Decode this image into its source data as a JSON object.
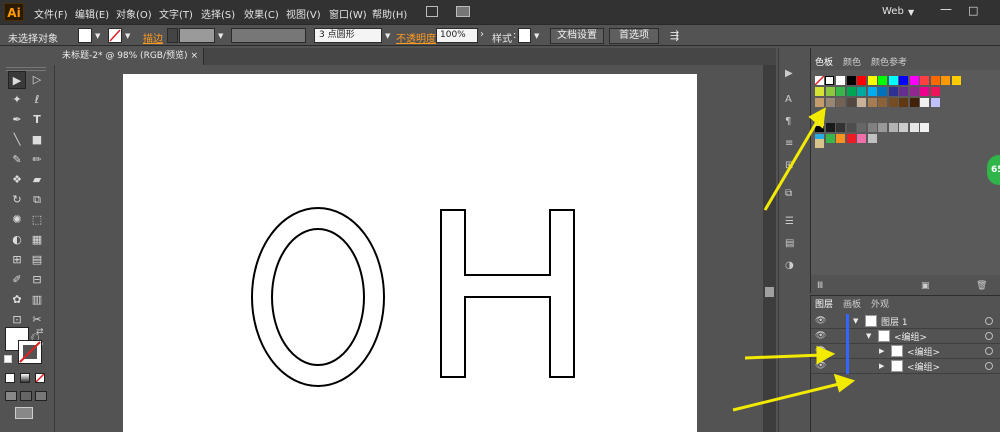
{
  "app": {
    "logo": "Ai",
    "workspace": "Web",
    "menu": [
      "文件(F)",
      "编辑(E)",
      "对象(O)",
      "文字(T)",
      "选择(S)",
      "效果(C)",
      "视图(V)",
      "窗口(W)",
      "帮助(H)"
    ]
  },
  "control_bar": {
    "selection_label": "未选择对象",
    "stroke_label": "描边",
    "brush_value": "3 点圆形",
    "opacity_label": "不透明度",
    "opacity_value": "100%",
    "style_label": "样式",
    "doc_setup": "文档设置",
    "preferences": "首选项"
  },
  "document": {
    "tab_title": "未标题-2* @ 98% (RGB/预览)",
    "close": "×",
    "artwork_text": "OH"
  },
  "swatches_panel": {
    "tabs": [
      "色板",
      "颜色",
      "颜色参考"
    ],
    "rows": [
      [
        "#ffffff",
        "#000000",
        "#ff0000",
        "#ffff00",
        "#00ff00",
        "#00ffff",
        "#0000ff",
        "#ff00ff",
        "#ff4040",
        "#ff6a00",
        "#ff9900",
        "#ffcc00"
      ],
      [
        "#d5e332",
        "#8dc63f",
        "#39b54a",
        "#00a651",
        "#00a99d",
        "#00aeef",
        "#0072bc",
        "#2e3192",
        "#662d91",
        "#92278f",
        "#ec008c",
        "#ed145b"
      ],
      [
        "#c69c6d",
        "#998675",
        "#736357",
        "#534741",
        "#c7b299",
        "#a67c52",
        "#8c6239",
        "#754c24",
        "#603913",
        "#42210b",
        "#f0f0f0",
        "#c0c0ff"
      ],
      [
        "#000000",
        "#1a1a1a",
        "#333333",
        "#4d4d4d",
        "#666666",
        "#808080",
        "#999999",
        "#b3b3b3",
        "#cccccc",
        "#e6e6e6",
        "#f2f2f2"
      ],
      [
        "#29abe2",
        "#39b54a",
        "#f7931e",
        "#ed1c24",
        "#f06eaa",
        "#c0c0c0"
      ]
    ]
  },
  "layers_panel": {
    "tabs": [
      "图层",
      "画板",
      "外观"
    ],
    "rows": [
      {
        "name": "图层 1",
        "indent": 0
      },
      {
        "name": "<编组>",
        "indent": 1
      },
      {
        "name": "<编组>",
        "indent": 2
      },
      {
        "name": "<编组>",
        "indent": 2
      }
    ]
  },
  "badge": "65"
}
